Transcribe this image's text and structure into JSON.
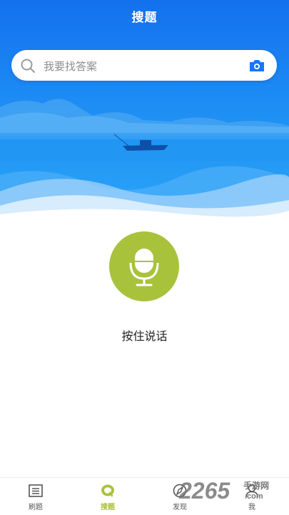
{
  "header": {
    "title": "搜题"
  },
  "search": {
    "placeholder": "我要找答案",
    "icons": [
      "search-icon",
      "camera-icon"
    ]
  },
  "voice": {
    "hold_label": "按住说话",
    "icon": "microphone-icon"
  },
  "tabbar": {
    "tabs": [
      {
        "label": "刷题",
        "icon": "list-icon",
        "active": false
      },
      {
        "label": "搜题",
        "icon": "search-bubble-icon",
        "active": true
      },
      {
        "label": "发现",
        "icon": "compass-icon",
        "active": false
      },
      {
        "label": "我",
        "icon": "user-icon",
        "active": false
      }
    ]
  },
  "watermark": {
    "text": "2265",
    "sub": "手游网",
    "domain": ".com"
  },
  "colors": {
    "hero_blue": "#1d8cf4",
    "accent_green": "#a9c23c",
    "camera_blue": "#1677ff"
  }
}
